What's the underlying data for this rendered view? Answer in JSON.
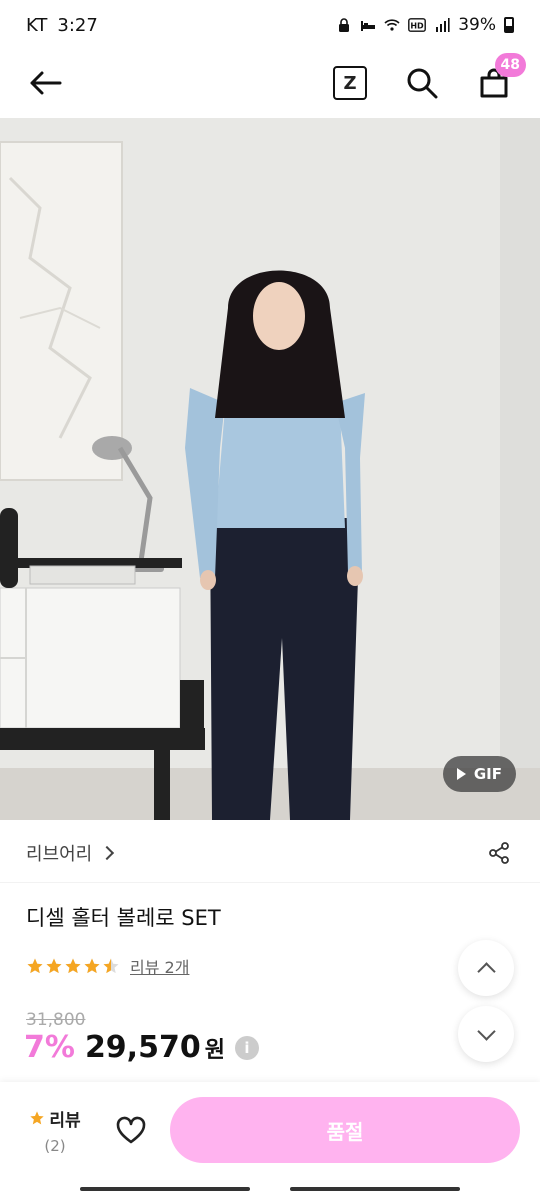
{
  "status_bar": {
    "carrier": "KT",
    "time": "3:27",
    "battery": "39%"
  },
  "header": {
    "z_label": "Z",
    "cart_count": "48"
  },
  "hero": {
    "gif_label": "GIF"
  },
  "product": {
    "brand": "리브어리",
    "title": "디셀 홀터 볼레로 SET",
    "rating": 4.5,
    "review_link": "리뷰 2개",
    "original_price": "31,800",
    "discount": "7%",
    "price": "29,570",
    "currency": "원",
    "info_symbol": "i"
  },
  "bottom_bar": {
    "review_label": "리뷰",
    "review_count": "(2)",
    "soldout_label": "품절"
  },
  "colors": {
    "accent_pink": "#f27ad9",
    "button_pink": "#ffb3ef",
    "star": "#f5a623"
  }
}
